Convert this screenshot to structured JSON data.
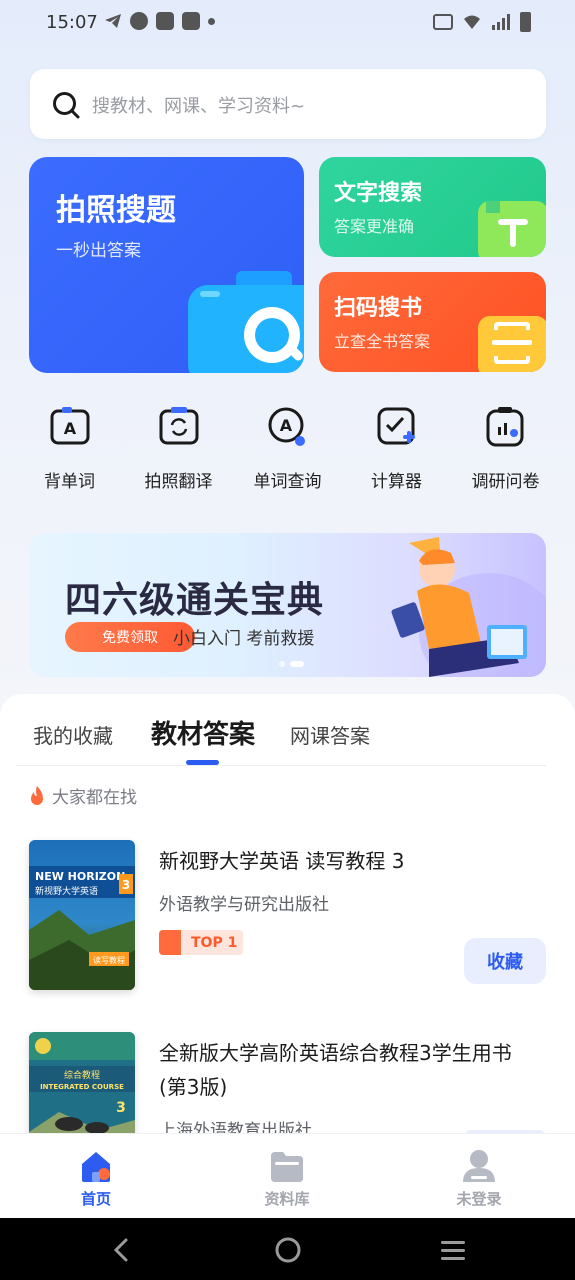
{
  "status_bar": {
    "time": "15:07"
  },
  "search": {
    "placeholder": "搜教材、网课、学习资料~"
  },
  "features": {
    "photo": {
      "title": "拍照搜题",
      "subtitle": "一秒出答案"
    },
    "text": {
      "title": "文字搜索",
      "subtitle": "答案更准确"
    },
    "scan": {
      "title": "扫码搜书",
      "subtitle": "立查全书答案"
    }
  },
  "tools": [
    {
      "label": "背单词",
      "icon": "vocab-book-icon"
    },
    {
      "label": "拍照翻译",
      "icon": "photo-translate-icon"
    },
    {
      "label": "单词查询",
      "icon": "word-lookup-icon"
    },
    {
      "label": "计算器",
      "icon": "calculator-icon"
    },
    {
      "label": "调研问卷",
      "icon": "survey-icon"
    }
  ],
  "banner": {
    "title": "四六级通关宝典",
    "button": "免费领取",
    "subtitle": "小白入门 考前救援"
  },
  "tabs": [
    {
      "label": "我的收藏",
      "active": false
    },
    {
      "label": "教材答案",
      "active": true
    },
    {
      "label": "网课答案",
      "active": false
    }
  ],
  "hot_label": "大家都在找",
  "books": [
    {
      "title": "新视野大学英语 读写教程 3",
      "publisher": "外语教学与研究出版社",
      "rank": "TOP 1",
      "action": "收藏",
      "cover_text": "NEW HORIZON 新视野大学英语",
      "cover_number": "3",
      "cover_tag": "读写教程"
    },
    {
      "title": "全新版大学高阶英语综合教程3学生用书(第3版)",
      "publisher": "上海外语教育出版社",
      "cover_text": "综合教程 INTEGRATED COURSE",
      "cover_number": "3"
    }
  ],
  "bottom_nav": [
    {
      "label": "首页",
      "active": true
    },
    {
      "label": "资料库",
      "active": false
    },
    {
      "label": "未登录",
      "active": false
    }
  ],
  "colors": {
    "primary": "#2c5cf0",
    "photo_card": "#3b6cff",
    "text_card": "#2fd59e",
    "scan_card": "#ff5a2a"
  }
}
